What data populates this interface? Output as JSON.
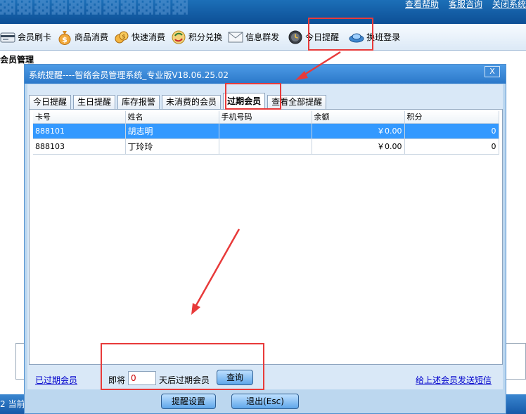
{
  "banner": {
    "links": [
      "查看帮助",
      "客服咨询",
      "关闭系统"
    ]
  },
  "toolbar": {
    "items": [
      {
        "label": "会员刷卡",
        "icon": "card-reader-icon"
      },
      {
        "label": "商品消费",
        "icon": "money-bag-icon"
      },
      {
        "label": "快速消费",
        "icon": "coins-icon"
      },
      {
        "label": "积分兑换",
        "icon": "exchange-icon"
      },
      {
        "label": "信息群发",
        "icon": "envelope-icon"
      },
      {
        "label": "今日提醒",
        "icon": "clock-icon"
      },
      {
        "label": "换班登录",
        "icon": "shift-login-icon"
      }
    ]
  },
  "section_title": "会员管理",
  "status_text": "2  当前",
  "dialog": {
    "title": "系统提醒----智络会员管理系统_专业版V18.06.25.02",
    "close_label": "X",
    "tabs": [
      "今日提醒",
      "生日提醒",
      "库存报警",
      "未消费的会员",
      "过期会员",
      "查看全部提醒"
    ],
    "active_tab": 4,
    "table": {
      "headers": [
        "卡号",
        "姓名",
        "手机号码",
        "余额",
        "积分"
      ],
      "rows": [
        {
          "card": "888101",
          "name": "胡志明",
          "phone": "",
          "balance": "￥0.00",
          "points": "0"
        },
        {
          "card": "888103",
          "name": "丁玲玲",
          "phone": "",
          "balance": "￥0.00",
          "points": "0"
        }
      ]
    },
    "expired_link": "已过期会员",
    "prefix_label": "即将",
    "days_value": "0",
    "suffix_label": "天后过期会员",
    "query_button": "查询",
    "sms_link": "给上述会员发送短信",
    "settings_button": "提醒设置",
    "exit_button": "退出(Esc)"
  }
}
